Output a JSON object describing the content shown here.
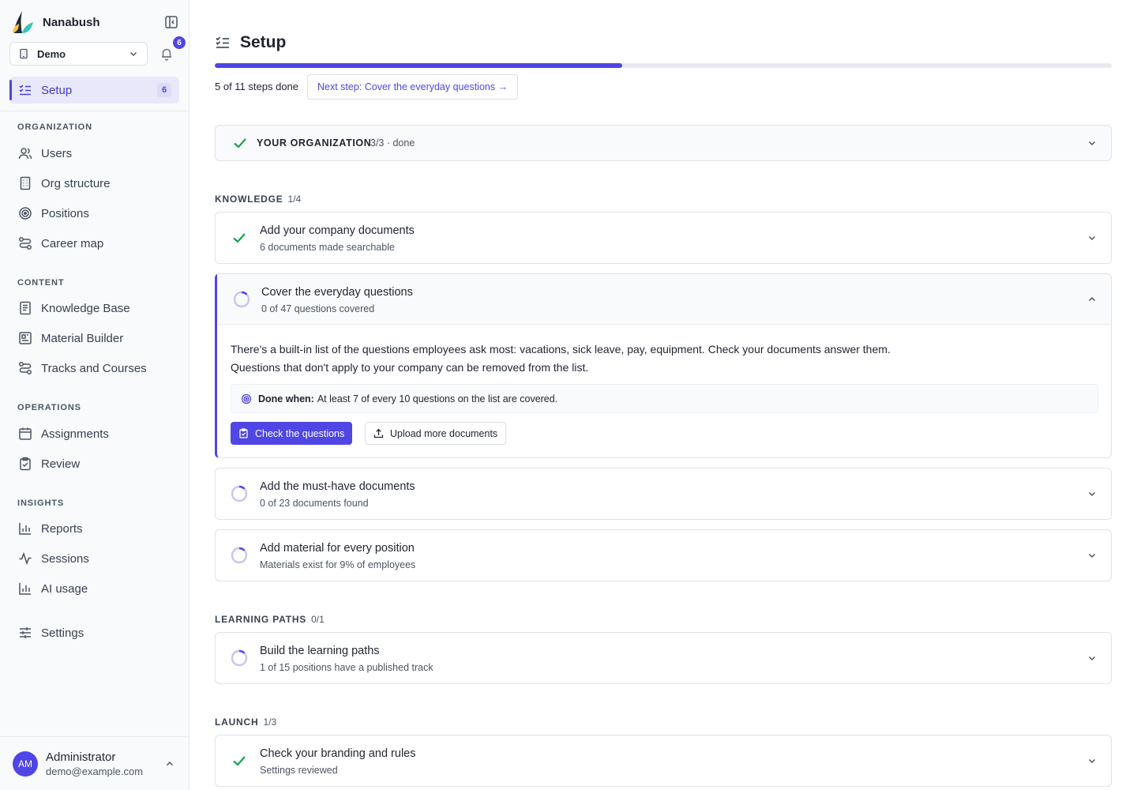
{
  "colors": {
    "accent": "#4f46e5",
    "success": "#16a34a",
    "pending_ring": "#c7c5f3"
  },
  "sidebar": {
    "brand_name": "Nanabush",
    "org_select": {
      "value": "Demo"
    },
    "notification_count": "6",
    "active_item": {
      "label": "Setup",
      "count": "6",
      "icon": "checklist-icon"
    },
    "sections": [
      {
        "title": "ORGANIZATION",
        "items": [
          {
            "label": "Users",
            "icon": "users-icon"
          },
          {
            "label": "Org structure",
            "icon": "building-icon"
          },
          {
            "label": "Positions",
            "icon": "target-icon"
          },
          {
            "label": "Career map",
            "icon": "route-icon"
          }
        ]
      },
      {
        "title": "CONTENT",
        "items": [
          {
            "label": "Knowledge Base",
            "icon": "book-icon"
          },
          {
            "label": "Material Builder",
            "icon": "layout-icon"
          },
          {
            "label": "Tracks and Courses",
            "icon": "route-icon"
          }
        ]
      },
      {
        "title": "OPERATIONS",
        "items": [
          {
            "label": "Assignments",
            "icon": "calendar-icon"
          },
          {
            "label": "Review",
            "icon": "clipboard-check-icon"
          }
        ]
      },
      {
        "title": "INSIGHTS",
        "items": [
          {
            "label": "Reports",
            "icon": "bar-chart-icon"
          },
          {
            "label": "Sessions",
            "icon": "activity-icon"
          },
          {
            "label": "AI usage",
            "icon": "bar-chart-icon"
          }
        ]
      }
    ],
    "settings_label": "Settings",
    "user": {
      "initials": "AM",
      "name": "Administrator",
      "email": "demo@example.com"
    }
  },
  "main": {
    "title": "Setup",
    "progress": {
      "done": 5,
      "total": 11,
      "fraction": 0.4545
    },
    "steps_done_text": "5 of 11 steps done",
    "next_step_label": "Next step: Cover the everyday questions →",
    "org_summary": {
      "title": "YOUR ORGANIZATION",
      "status": "3/3 · done"
    },
    "groups": {
      "knowledge": {
        "title": "KNOWLEDGE",
        "count": "1/4"
      },
      "learning": {
        "title": "LEARNING PATHS",
        "count": "0/1"
      },
      "launch": {
        "title": "LAUNCH",
        "count": "1/3"
      }
    },
    "steps": {
      "company_docs": {
        "title": "Add your company documents",
        "subtitle": "6 documents made searchable",
        "status": "done"
      },
      "everyday": {
        "title": "Cover the everyday questions",
        "subtitle": "0 of 47 questions covered",
        "status": "in-progress",
        "description_line1": "There's a built-in list of the questions employees ask most: vacations, sick leave, pay, equipment. Check your documents answer them.",
        "description_line2": "Questions that don't apply to your company can be removed from the list.",
        "done_when_label": "Done when:",
        "done_when_text": "At least 7 of every 10 questions on the list are covered.",
        "primary_button": "Check the questions",
        "secondary_button": "Upload more documents"
      },
      "must_have": {
        "title": "Add the must-have documents",
        "subtitle": "0 of 23 documents found",
        "status": "in-progress"
      },
      "material": {
        "title": "Add material for every position",
        "subtitle": "Materials exist for 9% of employees",
        "status": "in-progress"
      },
      "learning_paths": {
        "title": "Build the learning paths",
        "subtitle": "1 of 15 positions have a published track",
        "status": "in-progress"
      },
      "branding": {
        "title": "Check your branding and rules",
        "subtitle": "Settings reviewed",
        "status": "done"
      }
    }
  }
}
